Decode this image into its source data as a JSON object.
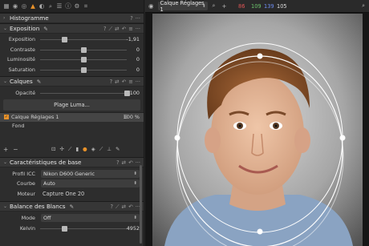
{
  "histogram": {
    "title": "Histogramme"
  },
  "exposure": {
    "title": "Exposition",
    "sliders": [
      {
        "label": "Exposition",
        "value": "-1,91",
        "pos": 0.28
      },
      {
        "label": "Contraste",
        "value": "0",
        "pos": 0.5
      },
      {
        "label": "Luminosité",
        "value": "0",
        "pos": 0.5
      },
      {
        "label": "Saturation",
        "value": "0",
        "pos": 0.5
      }
    ]
  },
  "layers": {
    "title": "Calques",
    "opacity_label": "Opacité",
    "opacity_value": "100",
    "opacity_pos": 1.0,
    "luma_button": "Plage Luma...",
    "items": [
      {
        "name": "Calque Réglages 1",
        "percent": "100 %",
        "selected": true
      },
      {
        "name": "Fond",
        "percent": "",
        "selected": false
      }
    ]
  },
  "base": {
    "title": "Caractéristiques de base",
    "rows": [
      {
        "label": "Profil ICC",
        "value": "Nikon D600 Generic",
        "type": "dropdown"
      },
      {
        "label": "Courbe",
        "value": "Auto",
        "type": "dropdown"
      },
      {
        "label": "Moteur",
        "value": "Capture One 20",
        "type": "text"
      }
    ]
  },
  "wb": {
    "title": "Balance des Blancs",
    "mode_label": "Mode",
    "mode_value": "Off",
    "kelvin_label": "Kelvin",
    "kelvin_value": "4952",
    "kelvin_pos": 0.28
  },
  "viewer": {
    "layer_select": "Calque Réglages 1",
    "rgb_r": "86",
    "rgb_g": "109",
    "rgb_b": "139",
    "rgb_l": "105"
  },
  "colors": {
    "accent": "#e8922a",
    "red": "#e05555",
    "green": "#6cc46c",
    "blue": "#6f8ef0"
  }
}
